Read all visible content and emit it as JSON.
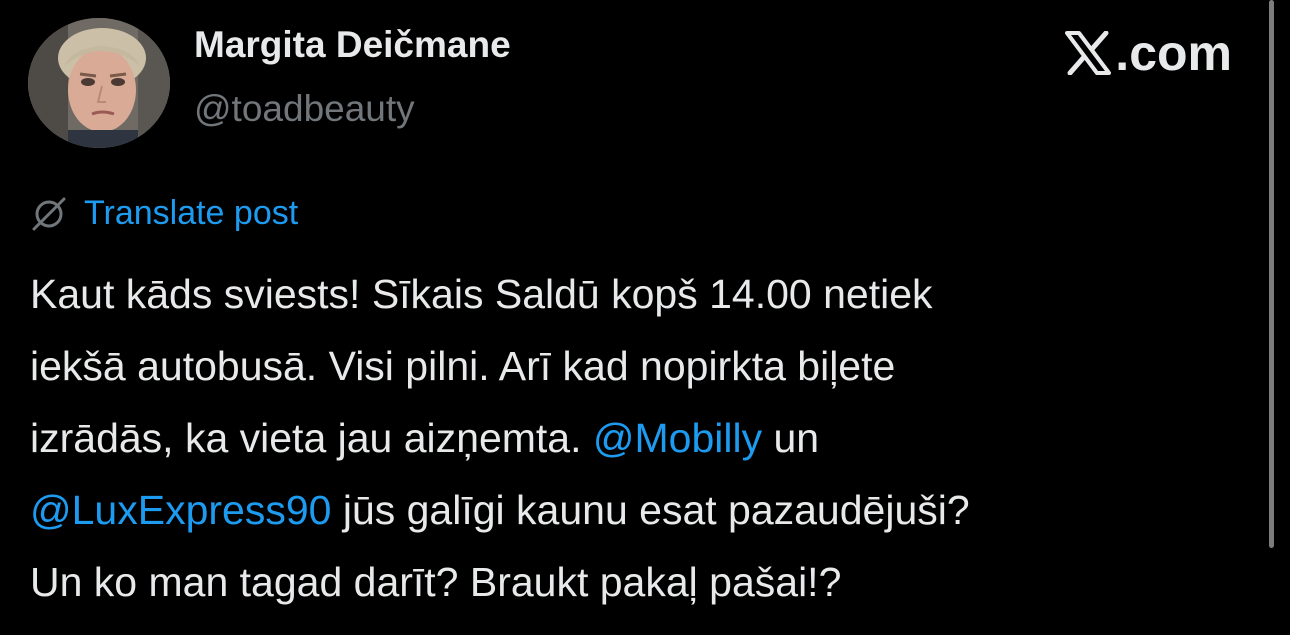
{
  "author": {
    "display_name": "Margita Deičmane",
    "handle": "@toadbeauty",
    "avatar_icon": "profile-photo"
  },
  "brand": {
    "label": ".com",
    "icon": "x-logo-icon"
  },
  "translate": {
    "label": "Translate post",
    "icon": "globe-slash-icon"
  },
  "post": {
    "lines": [
      "Kaut kāds sviests! Sīkais Saldū kopš 14.00 netiek",
      "iekšā autobusā. Visi pilni. Arī kad nopirkta biļete",
      "izrādās, ka vieta jau aizņemta. ",
      " un",
      "",
      " jūs galīgi kaunu esat pazaudējuši?",
      "Un ko man tagad darīt? Braukt pakaļ pašai!?"
    ],
    "mention_1": "@Mobilly",
    "mention_2": "@LuxExpress90"
  },
  "colors": {
    "background": "#000000",
    "text": "#e7e9ea",
    "secondary": "#71767b",
    "link": "#1d9bf0"
  }
}
